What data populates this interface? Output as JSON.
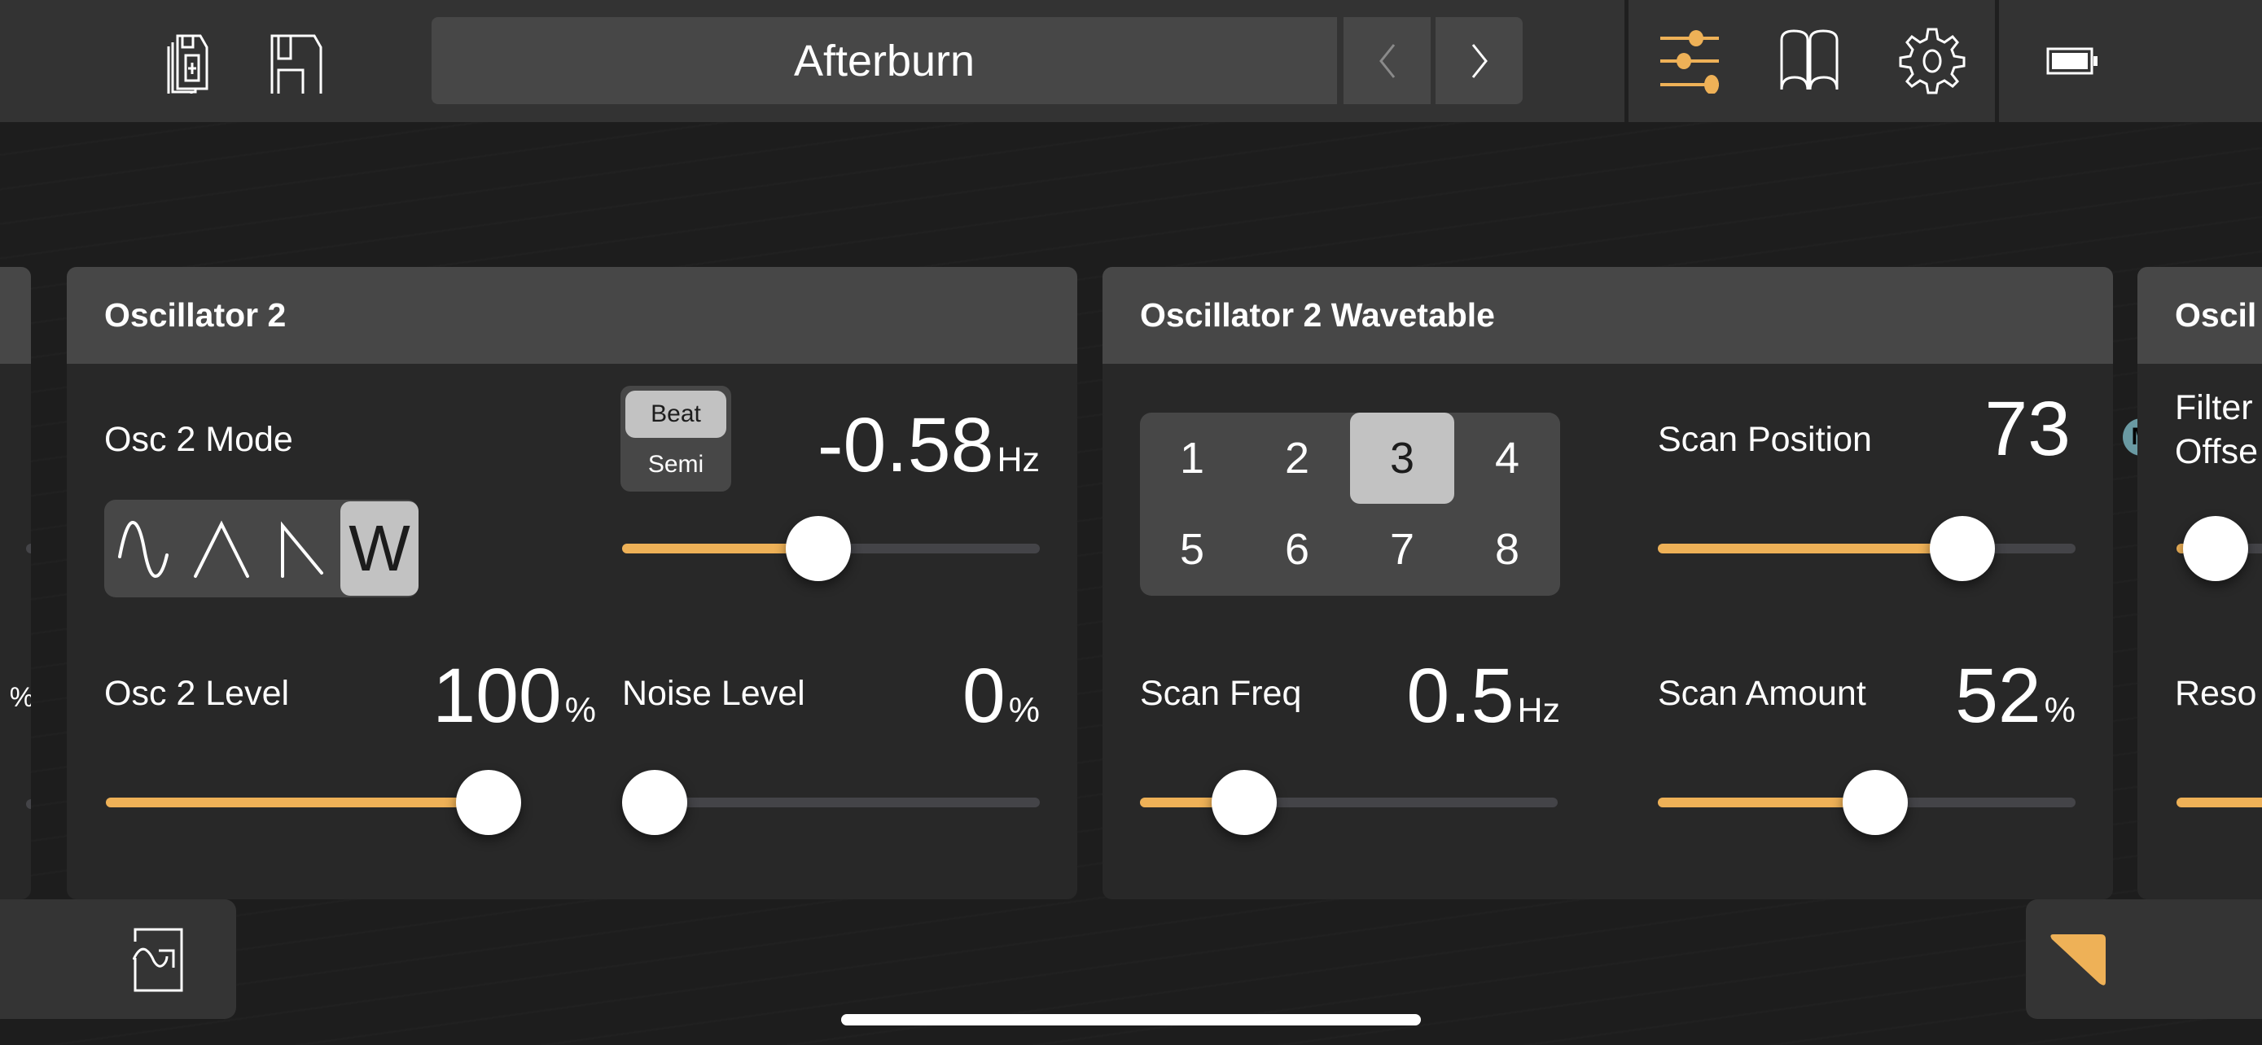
{
  "toolbar": {
    "preset_name": "Afterburn",
    "prev_label": "<",
    "next_label": ">",
    "icons": [
      "copy-preset-icon",
      "save-icon",
      "sliders-icon",
      "book-icon",
      "gear-icon",
      "battery-icon"
    ],
    "accent_color": "#eeb157"
  },
  "panels": {
    "osc2": {
      "title": "Oscillator 2",
      "mode": {
        "label": "Osc 2 Mode",
        "options": [
          "sine",
          "triangle",
          "saw",
          "W"
        ],
        "selected": "W"
      },
      "tune": {
        "toggle_options": [
          "Beat",
          "Semi"
        ],
        "toggle_selected": "Beat",
        "value": "-0.58",
        "unit": "Hz",
        "slider_fraction": 0.47
      },
      "level": {
        "label": "Osc 2 Level",
        "value": "100",
        "unit": "%",
        "slider_fraction": 1.0
      },
      "noise": {
        "label": "Noise Level",
        "value": "0",
        "unit": "%",
        "slider_fraction": 0.0
      }
    },
    "wavetable": {
      "title": "Oscillator 2 Wavetable",
      "table_buttons": [
        "1",
        "2",
        "3",
        "4",
        "5",
        "6",
        "7",
        "8"
      ],
      "table_selected": "3",
      "scan_position": {
        "label": "Scan Position",
        "value": "73",
        "unit": "",
        "slider_fraction": 0.73
      },
      "scan_freq": {
        "label": "Scan Freq",
        "value": "0.5",
        "unit": "Hz",
        "slider_fraction": 0.25
      },
      "scan_amount": {
        "label": "Scan Amount",
        "value": "52",
        "unit": "%",
        "slider_fraction": 0.52
      }
    },
    "partial_right": {
      "title": "Oscil",
      "filter_label_line1": "Filter",
      "filter_label_line2": "Offse",
      "mod_badge": "M",
      "reso_label": "Reso"
    },
    "partial_left": {
      "unit_fragment": "%"
    }
  },
  "bottom": {
    "left_icon": "wave-expand-icon",
    "right_icon": "corner-triangle-icon"
  }
}
